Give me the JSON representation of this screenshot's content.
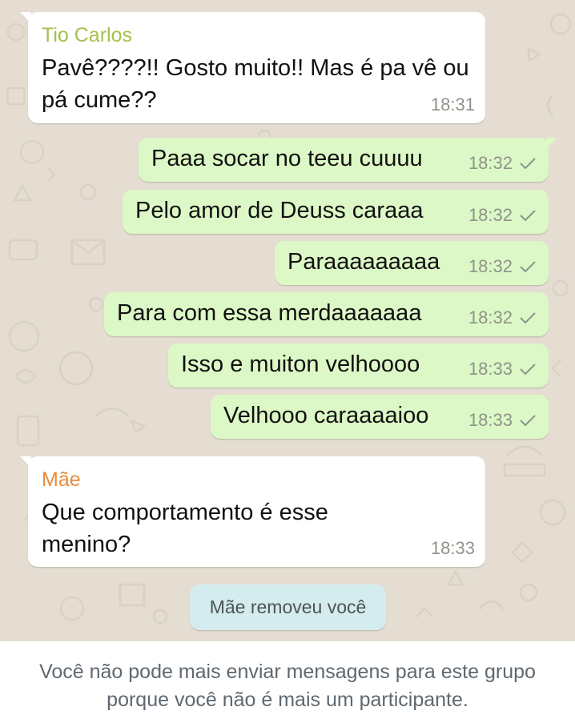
{
  "colors": {
    "chat_background": "#e5ddd2",
    "incoming_bubble": "#ffffff",
    "outgoing_bubble": "#dcf8c6",
    "system_notice": "#d5ecee",
    "sender_tio_carlos": "#a4c14c",
    "sender_mae": "#e88b3a"
  },
  "messages": {
    "tio_carlos": {
      "sender": "Tio Carlos",
      "text": "Pavê????!! Gosto muito!! Mas é pa vê ou pá cume??",
      "time": "18:31"
    },
    "sent": [
      {
        "text": "Paaa socar no teeu cuuuu",
        "time": "18:32",
        "status_icon": "check-icon"
      },
      {
        "text": "Pelo amor de Deuss caraaa",
        "time": "18:32",
        "status_icon": "check-icon"
      },
      {
        "text": "Paraaaaaaaaa",
        "time": "18:32",
        "status_icon": "check-icon"
      },
      {
        "text": "Para com essa merdaaaaaaa",
        "time": "18:32",
        "status_icon": "check-icon"
      },
      {
        "text": "Isso e muiton velhoooo",
        "time": "18:33",
        "status_icon": "check-icon"
      },
      {
        "text": "Velhooo caraaaaioo",
        "time": "18:33",
        "status_icon": "check-icon"
      }
    ],
    "mae": {
      "sender": "Mãe",
      "text": "Que comportamento é esse menino?",
      "time": "18:33"
    }
  },
  "system_notice": "Mãe removeu você",
  "footer": {
    "notice": "Você não pode mais enviar mensagens para este grupo porque você não é mais um participante."
  }
}
